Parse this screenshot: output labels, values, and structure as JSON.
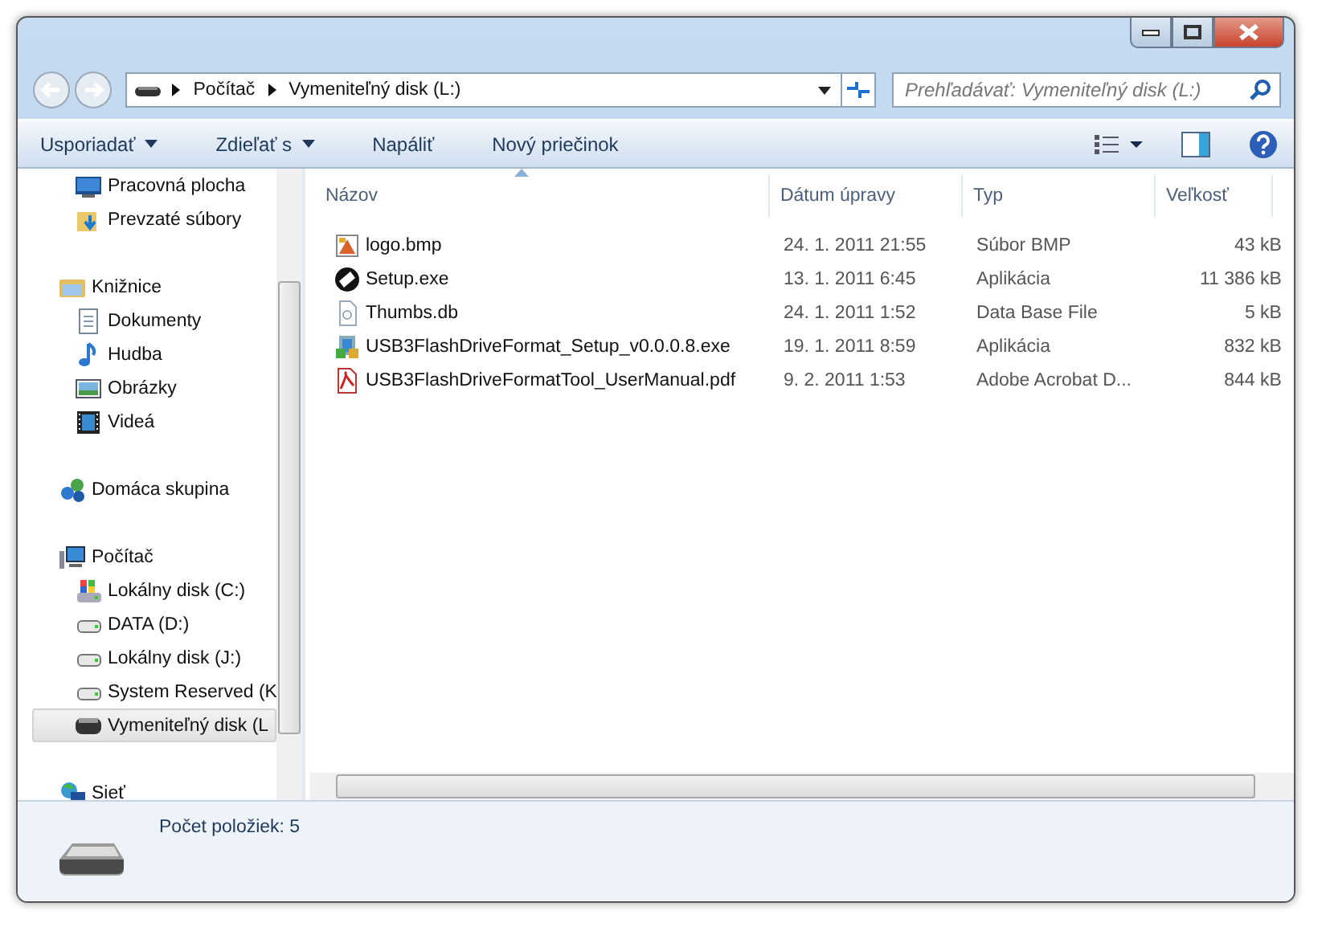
{
  "address": {
    "crumbs": [
      "Počítač",
      "Vymeniteľný disk (L:)"
    ]
  },
  "search": {
    "placeholder": "Prehľadávať: Vymeniteľný disk (L:)"
  },
  "toolbar": {
    "buttons": [
      {
        "label": "Usporiadať",
        "dropdown": true
      },
      {
        "label": "Zdieľať s",
        "dropdown": true
      },
      {
        "label": "Napáliť",
        "dropdown": false
      },
      {
        "label": "Nový priečinok",
        "dropdown": false
      }
    ]
  },
  "sidebar": {
    "groups": [
      {
        "children": [
          {
            "label": "Pracovná plocha",
            "kind": "desktop",
            "selected": false
          },
          {
            "label": "Prevzaté súbory",
            "kind": "download",
            "selected": false
          }
        ]
      },
      {
        "label": "Knižnice",
        "kind": "library",
        "selected": false,
        "children": [
          {
            "label": "Dokumenty",
            "kind": "document",
            "selected": false
          },
          {
            "label": "Hudba",
            "kind": "music",
            "selected": false
          },
          {
            "label": "Obrázky",
            "kind": "picture",
            "selected": false
          },
          {
            "label": "Videá",
            "kind": "video",
            "selected": false
          }
        ]
      },
      {
        "label": "Domáca skupina",
        "kind": "homegroup",
        "selected": false
      },
      {
        "label": "Počítač",
        "kind": "computer",
        "selected": false,
        "children": [
          {
            "label": "Lokálny disk (C:)",
            "kind": "system-drive",
            "selected": false
          },
          {
            "label": "DATA (D:)",
            "kind": "drive",
            "selected": false
          },
          {
            "label": "Lokálny disk (J:)",
            "kind": "drive",
            "selected": false
          },
          {
            "label": "System Reserved (K",
            "kind": "drive",
            "selected": false
          },
          {
            "label": "Vymeniteľný disk (L",
            "kind": "removable",
            "selected": true
          }
        ]
      },
      {
        "label": "Sieť",
        "kind": "network",
        "selected": false
      }
    ]
  },
  "table": {
    "columns": [
      "Názov",
      "Dátum úpravy",
      "Typ",
      "Veľkosť"
    ],
    "rows": [
      {
        "kind": "bitmap",
        "cells": [
          "logo.bmp",
          "24. 1. 2011 21:55",
          "Súbor BMP",
          "43 kB"
        ]
      },
      {
        "kind": "setup",
        "cells": [
          "Setup.exe",
          "13. 1. 2011 6:45",
          "Aplikácia",
          "11 386 kB"
        ]
      },
      {
        "kind": "database",
        "cells": [
          "Thumbs.db",
          "24. 1. 2011 1:52",
          "Data Base File",
          "5 kB"
        ]
      },
      {
        "kind": "installer",
        "cells": [
          "USB3FlashDriveFormat_Setup_v0.0.0.8.exe",
          "19. 1. 2011 8:59",
          "Aplikácia",
          "832 kB"
        ]
      },
      {
        "kind": "pdf",
        "cells": [
          "USB3FlashDriveFormatTool_UserManual.pdf",
          "9. 2. 2011 1:53",
          "Adobe Acrobat D...",
          "844 kB"
        ]
      }
    ]
  },
  "status_bar": {
    "text": "Počet položiek: 5"
  }
}
